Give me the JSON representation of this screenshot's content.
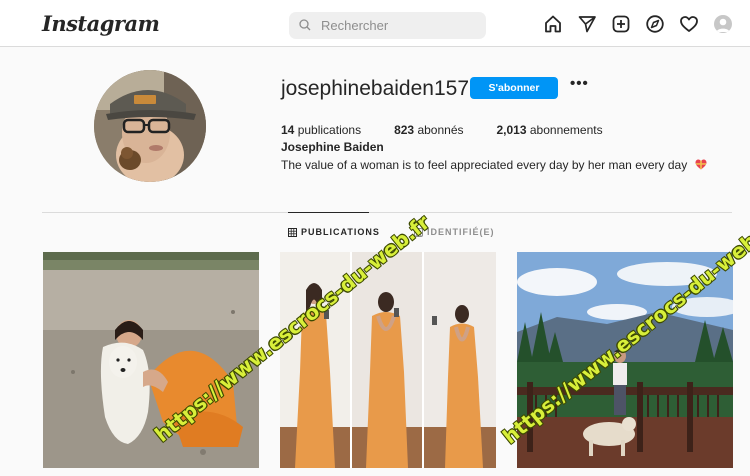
{
  "nav": {
    "logo": "Instagram",
    "search_placeholder": "Rechercher",
    "icons": [
      "home-icon",
      "direct-messages-icon",
      "new-post-icon",
      "explore-icon",
      "activity-heart-icon",
      "profile-avatar"
    ]
  },
  "profile": {
    "username": "josephinebaiden157",
    "follow_label": "S'abonner",
    "more_label": "•••",
    "stats": {
      "posts_count": "14",
      "posts_label": "publications",
      "followers_count": "823",
      "followers_label": "abonnés",
      "following_count": "2,013",
      "following_label": "abonnements"
    },
    "full_name": "Josephine Baiden",
    "bio": "The value of a woman is to feel appreciated every day by her man every day",
    "bio_emoji": "heart-gift-emoji"
  },
  "tabs": [
    {
      "label": "PUBLICATIONS",
      "icon": "grid-icon",
      "active": true
    },
    {
      "label": "IDENTIFIÉ(E)",
      "icon": "tagged-icon",
      "active": false
    }
  ],
  "posts": [
    {
      "description": "woman in orange dress hugging white dog on gravel"
    },
    {
      "description": "three mirror selfies in orange dress"
    },
    {
      "description": "woman on deck with dog, mountains behind"
    }
  ],
  "watermark": "https://www.escrocs-du-web.fr",
  "colors": {
    "accent": "#0095f6",
    "watermark": "#d8ef3a",
    "text": "#262626",
    "muted": "#8e8e8e"
  }
}
